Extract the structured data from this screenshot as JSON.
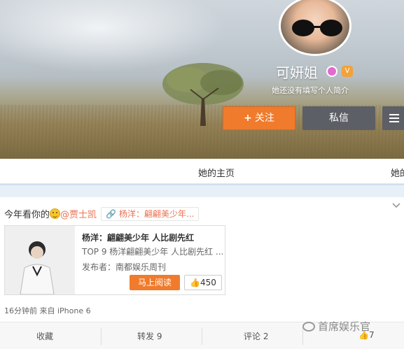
{
  "profile": {
    "nickname": "可妍姐",
    "bio": "她还没有填写个人简介",
    "follow_label": "关注",
    "follow_plus": "+",
    "message_label": "私信",
    "badge_vip": "V"
  },
  "tabs": {
    "home": "她的主页",
    "other": "她的"
  },
  "post": {
    "text_prefix": "今年看你的",
    "mention": "@贾士凯",
    "link_chip": "杨洋：翩翩美少年...",
    "article": {
      "title": "杨洋：翩翩美少年 人比剧先红",
      "desc": "TOP 9 杨洋翩翩美少年 人比剧先红 ...",
      "publisher_label": "发布者：",
      "publisher": "南都娱乐周刊",
      "read_button": "马上阅读",
      "like_count": "450"
    },
    "meta": "16分钟前 来自 iPhone 6"
  },
  "actions": {
    "favorite": "收藏",
    "repost": "转发 9",
    "comment": "评论 2",
    "like": "7"
  },
  "watermark": "首席娱乐官",
  "colors": {
    "accent": "#f07b2c",
    "mention": "#eb7350",
    "dark_button": "#5c5f66"
  },
  "icons": [
    "search-icon"
  ]
}
